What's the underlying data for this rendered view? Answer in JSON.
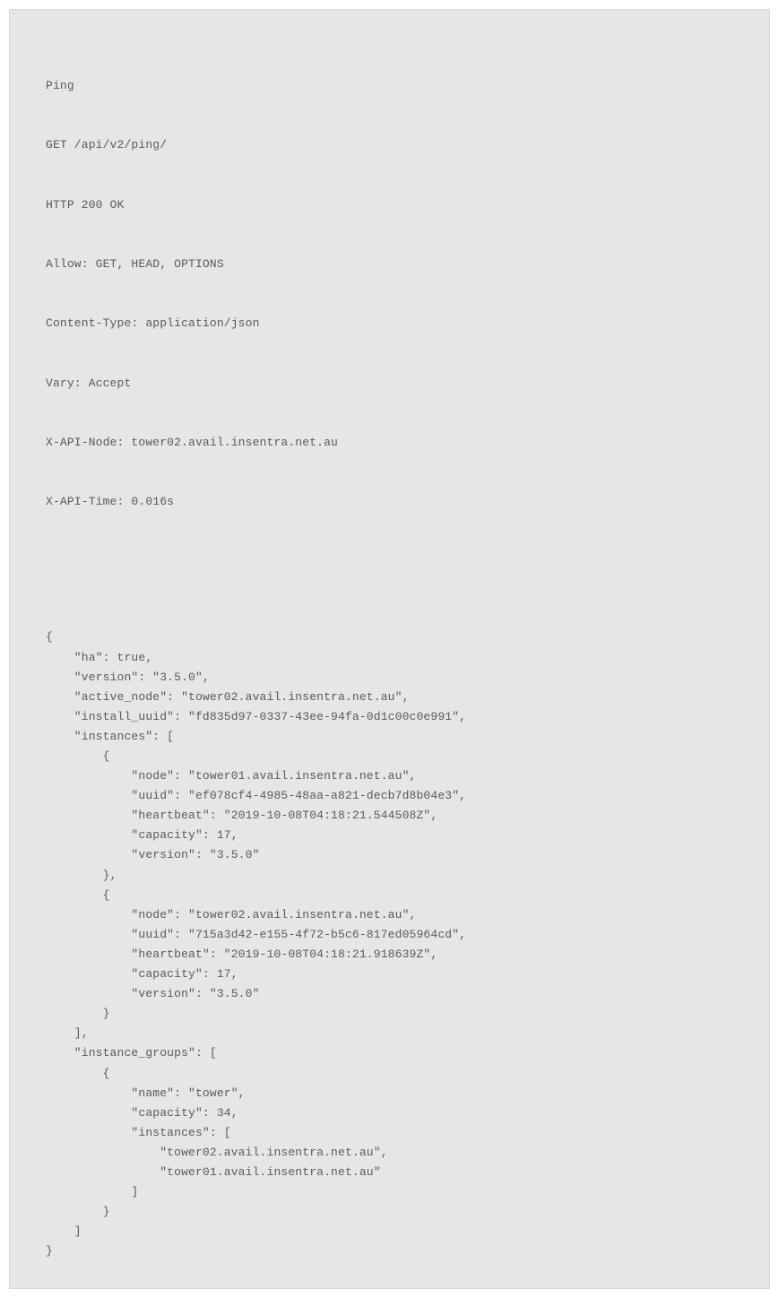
{
  "header": {
    "title": "Ping",
    "request": "GET /api/v2/ping/",
    "status": "HTTP 200 OK",
    "allow": "Allow: GET, HEAD, OPTIONS",
    "content_type": "Content-Type: application/json",
    "vary": "Vary: Accept",
    "x_api_node": "X-API-Node: tower02.avail.insentra.net.au",
    "x_api_time": "X-API-Time: 0.016s"
  },
  "json_body": "{\n    \"ha\": true,\n    \"version\": \"3.5.0\",\n    \"active_node\": \"tower02.avail.insentra.net.au\",\n    \"install_uuid\": \"fd835d97-0337-43ee-94fa-0d1c00c0e991\",\n    \"instances\": [\n        {\n            \"node\": \"tower01.avail.insentra.net.au\",\n            \"uuid\": \"ef078cf4-4985-48aa-a821-decb7d8b04e3\",\n            \"heartbeat\": \"2019-10-08T04:18:21.544508Z\",\n            \"capacity\": 17,\n            \"version\": \"3.5.0\"\n        },\n        {\n            \"node\": \"tower02.avail.insentra.net.au\",\n            \"uuid\": \"715a3d42-e155-4f72-b5c6-817ed05964cd\",\n            \"heartbeat\": \"2019-10-08T04:18:21.918639Z\",\n            \"capacity\": 17,\n            \"version\": \"3.5.0\"\n        }\n    ],\n    \"instance_groups\": [\n        {\n            \"name\": \"tower\",\n            \"capacity\": 34,\n            \"instances\": [\n                \"tower02.avail.insentra.net.au\",\n                \"tower01.avail.insentra.net.au\"\n            ]\n        }\n    ]\n}"
}
